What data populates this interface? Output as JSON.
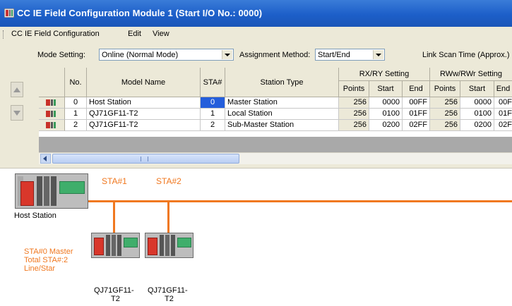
{
  "window": {
    "title": "CC IE Field Configuration Module 1 (Start I/O No.: 0000)"
  },
  "menu": [
    {
      "label": "CC IE Field Configuration"
    },
    {
      "label": "Edit"
    },
    {
      "label": "View"
    }
  ],
  "settings": {
    "mode_label": "Mode Setting:",
    "mode_value": "Online (Normal Mode)",
    "assign_label": "Assignment Method:",
    "assign_value": "Start/End",
    "link_scan_label": "Link Scan Time (Approx.)"
  },
  "table": {
    "headers": {
      "no": "No.",
      "model": "Model Name",
      "sta": "STA#",
      "station_type": "Station Type",
      "rxry": "RX/RY Setting",
      "rww": "RWw/RWr Setting",
      "points": "Points",
      "start": "Start",
      "end": "End"
    },
    "rows": [
      {
        "no": "0",
        "model": "Host Station",
        "sta": "0",
        "type": "Master Station",
        "rx_points": "256",
        "rx_start": "0000",
        "rx_end": "00FF",
        "rw_points": "256",
        "rw_start": "0000",
        "rw_end": "00F"
      },
      {
        "no": "1",
        "model": "QJ71GF11-T2",
        "sta": "1",
        "type": "Local Station",
        "rx_points": "256",
        "rx_start": "0100",
        "rx_end": "01FF",
        "rw_points": "256",
        "rw_start": "0100",
        "rw_end": "01F"
      },
      {
        "no": "2",
        "model": "QJ71GF11-T2",
        "sta": "2",
        "type": "Sub-Master Station",
        "rx_points": "256",
        "rx_start": "0200",
        "rx_end": "02FF",
        "rw_points": "256",
        "rw_start": "0200",
        "rw_end": "02F"
      }
    ]
  },
  "diagram": {
    "host_label": "Host Station",
    "sta1": "STA#1",
    "sta2": "STA#2",
    "master_info_1": "STA#0  Master",
    "master_info_2": "Total STA#:2",
    "master_info_3": "Line/Star",
    "node1_label_1": "QJ71GF11-",
    "node1_label_2": "T2",
    "node2_label_1": "QJ71GF11-",
    "node2_label_2": "T2"
  },
  "colors": {
    "title_bar": "#1d5fc9",
    "selected_cell": "#245edb",
    "network_line": "#f07820",
    "cpu_red": "#d9372b",
    "io_green": "#3fae6b"
  }
}
